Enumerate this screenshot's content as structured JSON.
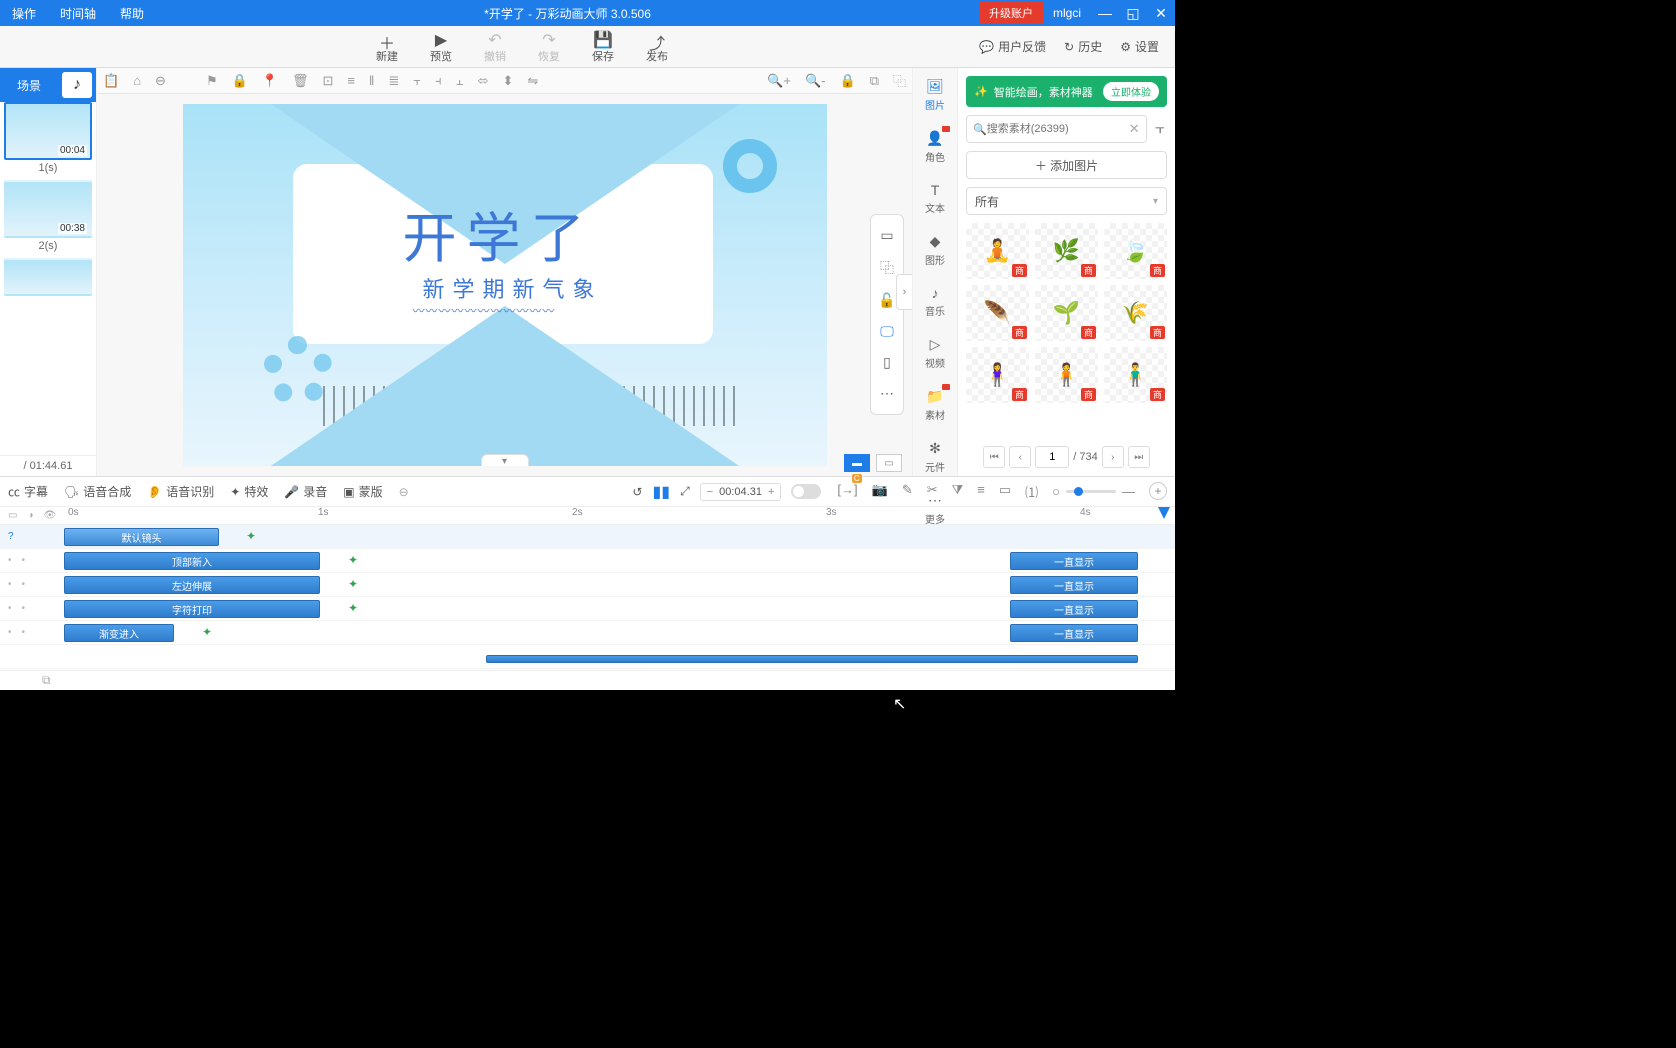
{
  "titlebar": {
    "menus": [
      "操作",
      "时间轴",
      "帮助"
    ],
    "title": "*开学了 - 万彩动画大师 3.0.506",
    "upgrade": "升级账户",
    "user": "mlgci"
  },
  "maintoolbar": {
    "items": [
      {
        "label": "新建",
        "icon": "＋"
      },
      {
        "label": "预览",
        "icon": "▶"
      },
      {
        "label": "撤销",
        "icon": "↶",
        "disabled": true
      },
      {
        "label": "恢复",
        "icon": "↷",
        "disabled": true
      },
      {
        "label": "保存",
        "icon": "💾"
      },
      {
        "label": "发布",
        "icon": "⤴"
      }
    ],
    "right": [
      {
        "label": "用户反馈",
        "icon": "💬"
      },
      {
        "label": "历史",
        "icon": "↻"
      },
      {
        "label": "设置",
        "icon": "⚙"
      }
    ]
  },
  "scenepanel": {
    "tab": "场景",
    "items": [
      {
        "dur": "00:04",
        "idx": "1(s)"
      },
      {
        "dur": "00:38",
        "idx": "2(s)"
      },
      {
        "dur": "",
        "idx": ""
      }
    ],
    "total": "/ 01:44.61"
  },
  "stage": {
    "title": "开学了",
    "subtitle": "新学期新气象",
    "wave": "〰〰〰〰〰〰〰〰〰〰〰"
  },
  "dock": {
    "items": [
      {
        "label": "图片",
        "icon": "🖼",
        "active": true
      },
      {
        "label": "角色",
        "icon": "👤",
        "hot": true
      },
      {
        "label": "文本",
        "icon": "T"
      },
      {
        "label": "图形",
        "icon": "◆"
      },
      {
        "label": "音乐",
        "icon": "♪"
      },
      {
        "label": "视频",
        "icon": "▷"
      },
      {
        "label": "素材",
        "icon": "📁",
        "hot": true
      },
      {
        "label": "元件",
        "icon": "✻"
      },
      {
        "label": "更多",
        "icon": "⋯"
      }
    ]
  },
  "assets": {
    "ai_banner_text": "智能绘画，素材神器",
    "ai_banner_btn": "立即体验",
    "search_placeholder": "搜索素材(26399)",
    "add_image": "＋ 添加图片",
    "category": "所有",
    "badge": "商",
    "pager": {
      "page": "1",
      "total": "/ 734"
    }
  },
  "timeline": {
    "tools": [
      "字幕",
      "语音合成",
      "语音识别",
      "特效",
      "录音",
      "蒙版"
    ],
    "time": "00:04.31",
    "ruler": [
      "0s",
      "1s",
      "2s",
      "3s",
      "4s"
    ],
    "cam_badge": "C",
    "tracks": {
      "camera": {
        "label": "默认镜头"
      },
      "rows": [
        {
          "in": "顶部新入",
          "out": "一直显示"
        },
        {
          "in": "左边伸展",
          "out": "一直显示"
        },
        {
          "in": "字符打印",
          "out": "一直显示"
        },
        {
          "in": "渐变进入",
          "out": "一直显示"
        }
      ]
    }
  }
}
